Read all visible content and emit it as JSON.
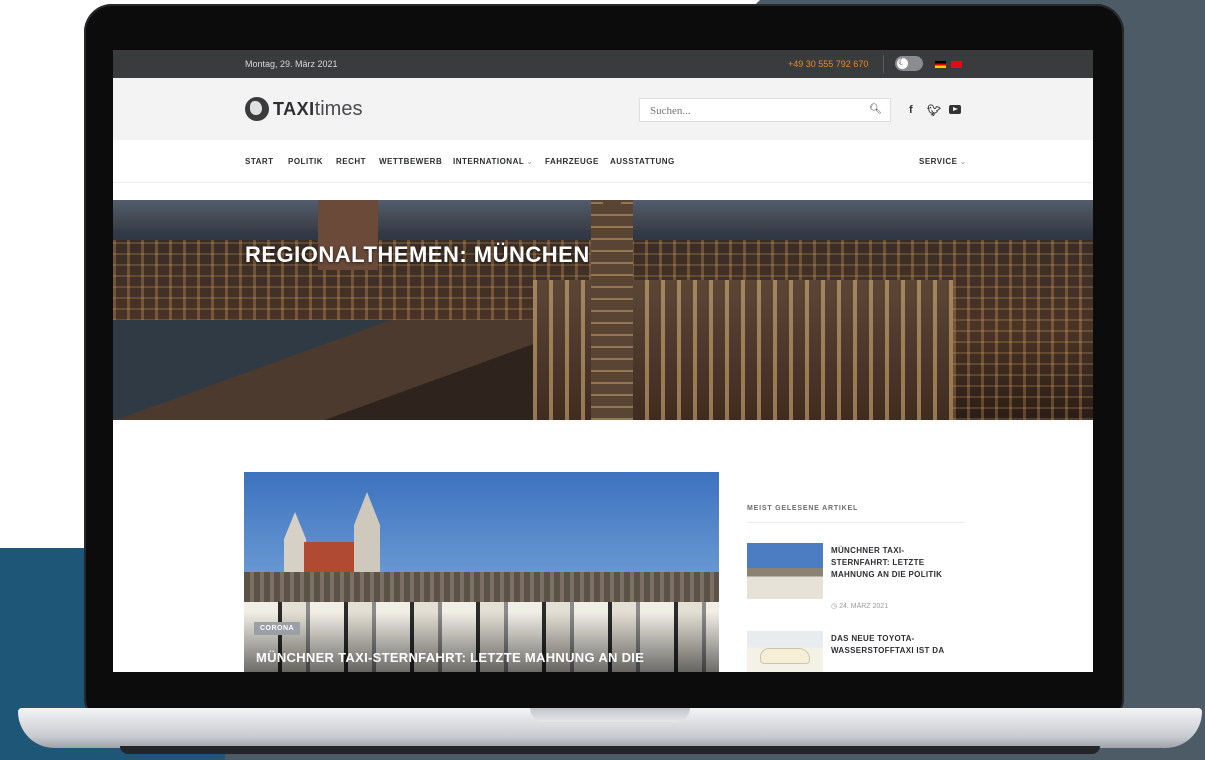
{
  "topbar": {
    "date": "Montag, 29. März 2021",
    "phone": "+49 30 555 792 670",
    "theme_toggle_icon": "moon-icon",
    "languages": [
      "de",
      "tr"
    ]
  },
  "header": {
    "logo_bold": "TAXI",
    "logo_light": "times",
    "search": {
      "placeholder": "Suchen..."
    },
    "social": {
      "facebook": "f",
      "twitter": "🐦"
    }
  },
  "nav": {
    "items": [
      {
        "label": "START"
      },
      {
        "label": "POLITIK"
      },
      {
        "label": "RECHT"
      },
      {
        "label": "WETTBEWERB"
      },
      {
        "label": "INTERNATIONAL"
      },
      {
        "label": "FAHRZEUGE"
      },
      {
        "label": "AUSSTATTUNG"
      }
    ],
    "service": "SERVICE"
  },
  "hero": {
    "title": "REGIONALTHEMEN: MÜNCHEN"
  },
  "feature": {
    "badge": "CORONA",
    "title": "MÜNCHNER TAXI-STERNFAHRT: LETZTE MAHNUNG AN DIE"
  },
  "sidebar": {
    "title": "MEIST GELESENE ARTIKEL",
    "articles": [
      {
        "title": "MÜNCHNER TAXI-STERNFAHRT: LETZTE MAHNUNG AN DIE POLITIK",
        "date": "24. MÄRZ 2021"
      },
      {
        "title": "DAS NEUE TOYOTA-WASSERSTOFFTAXI IST DA"
      }
    ]
  },
  "colors": {
    "accent_phone": "#e88a2b",
    "topbar": "#3a3b3d",
    "background_slate": "#4d5b67",
    "background_blue": "#1d5677"
  }
}
